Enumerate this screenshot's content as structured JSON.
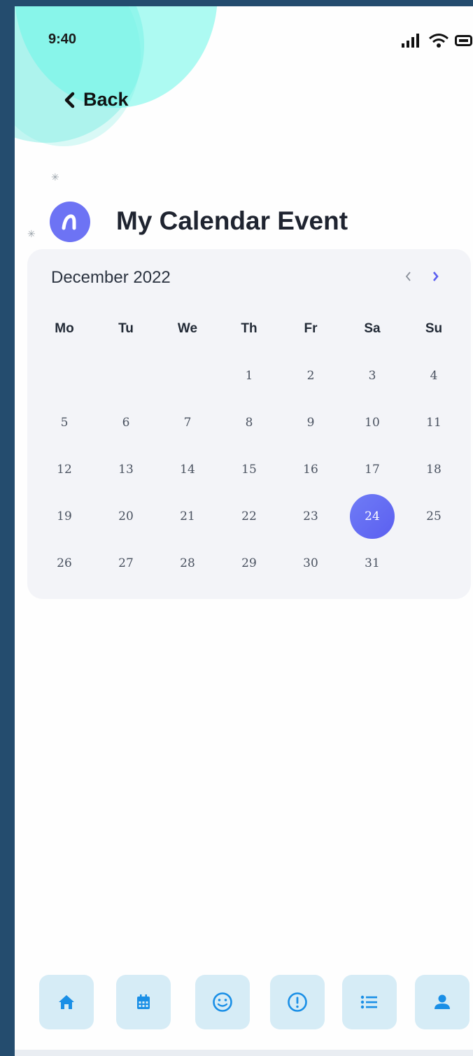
{
  "status_bar": {
    "time": "9:40"
  },
  "header": {
    "back_label": "Back",
    "title": "My Calendar Event"
  },
  "calendar": {
    "month_label": "December 2022",
    "weekdays": [
      "Mo",
      "Tu",
      "We",
      "Th",
      "Fr",
      "Sa",
      "Su"
    ],
    "days": [
      "1",
      "2",
      "3",
      "4",
      "5",
      "6",
      "7",
      "8",
      "9",
      "10",
      "11",
      "12",
      "13",
      "14",
      "15",
      "16",
      "17",
      "18",
      "19",
      "20",
      "21",
      "22",
      "23",
      "24",
      "25",
      "26",
      "27",
      "28",
      "29",
      "30",
      "31"
    ],
    "selected_day": "24",
    "prev_icon": "chevron-left-icon",
    "next_icon": "chevron-right-icon"
  },
  "tabbar": {
    "items": [
      {
        "icon": "home-icon"
      },
      {
        "icon": "calendar-icon"
      },
      {
        "icon": "smiley-icon"
      },
      {
        "icon": "alert-icon"
      },
      {
        "icon": "list-icon"
      },
      {
        "icon": "user-icon"
      }
    ]
  },
  "colors": {
    "accent": "#5b5ff0",
    "tab_bg": "#d6ecf6",
    "tab_icon": "#1a8fe6",
    "calendar_bg": "#f3f4f8",
    "frame": "#244c6e"
  }
}
